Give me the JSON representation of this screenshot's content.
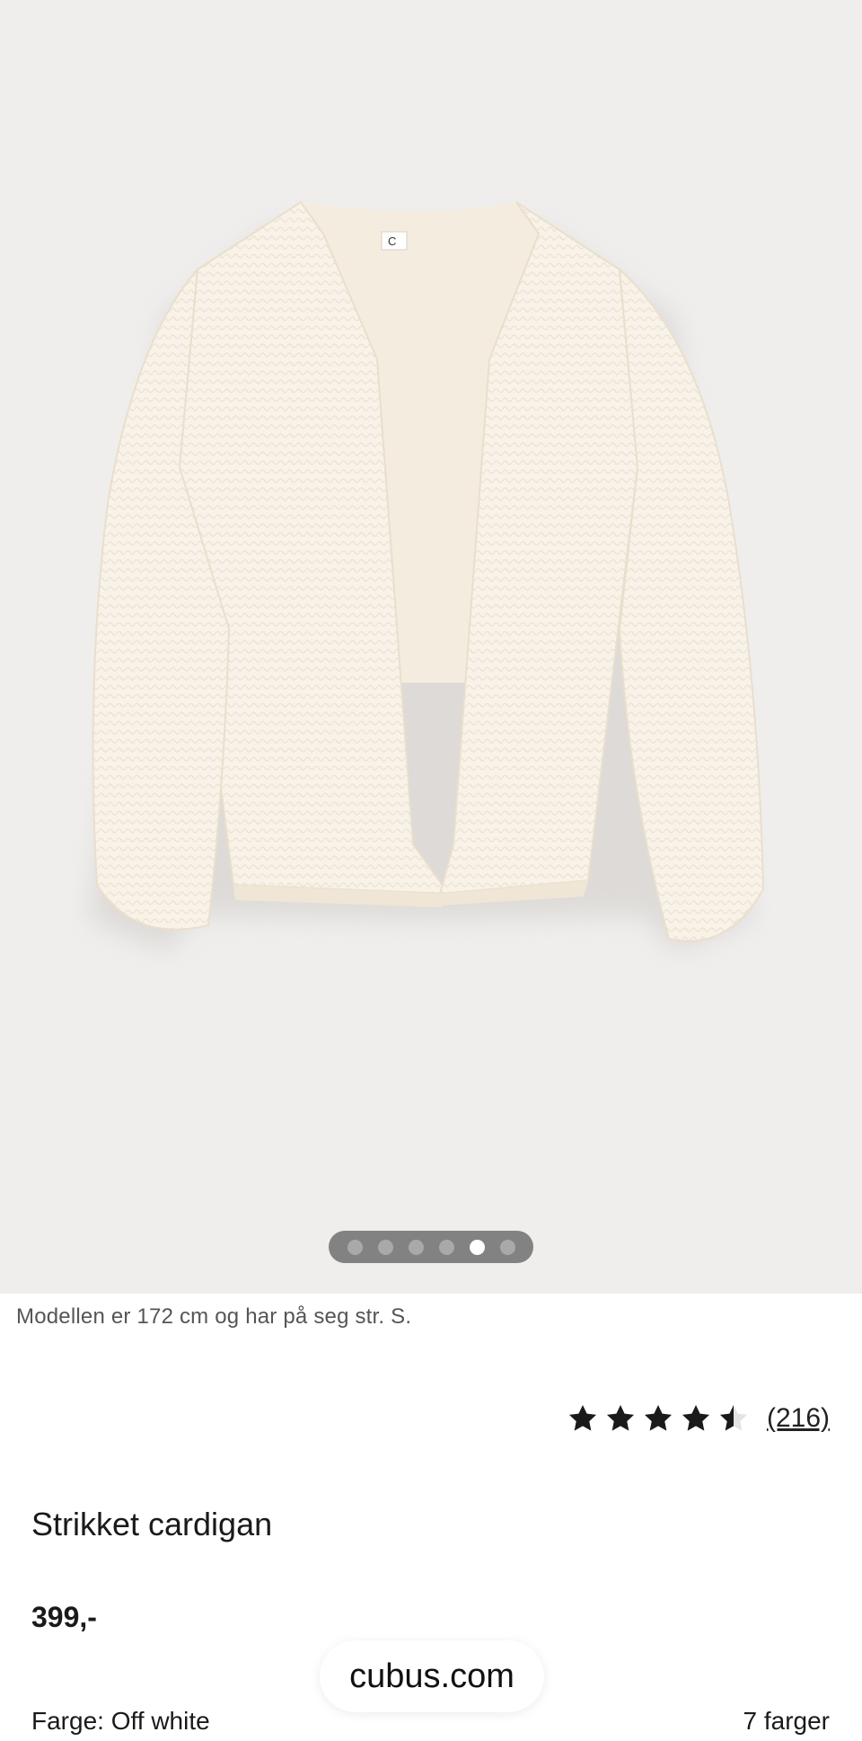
{
  "product_image": {
    "alt_icon": "cardigan-image",
    "label_tag_text": "C"
  },
  "carousel": {
    "count": 6,
    "active_index": 4
  },
  "model_note": "Modellen er 172 cm og har på seg str. S.",
  "rating": {
    "stars_value": 4.5,
    "stars_max": 5,
    "review_count": "(216)",
    "star_color": "#1a1a1a"
  },
  "product": {
    "title": "Strikket cardigan",
    "price": "399,-"
  },
  "browser": {
    "domain": "cubus.com"
  },
  "color_selector": {
    "label": "Farge: Off white",
    "count_label": "7 farger"
  },
  "colors": {
    "hero_background": "#efeeed",
    "cardigan": "#f7f1e6"
  }
}
